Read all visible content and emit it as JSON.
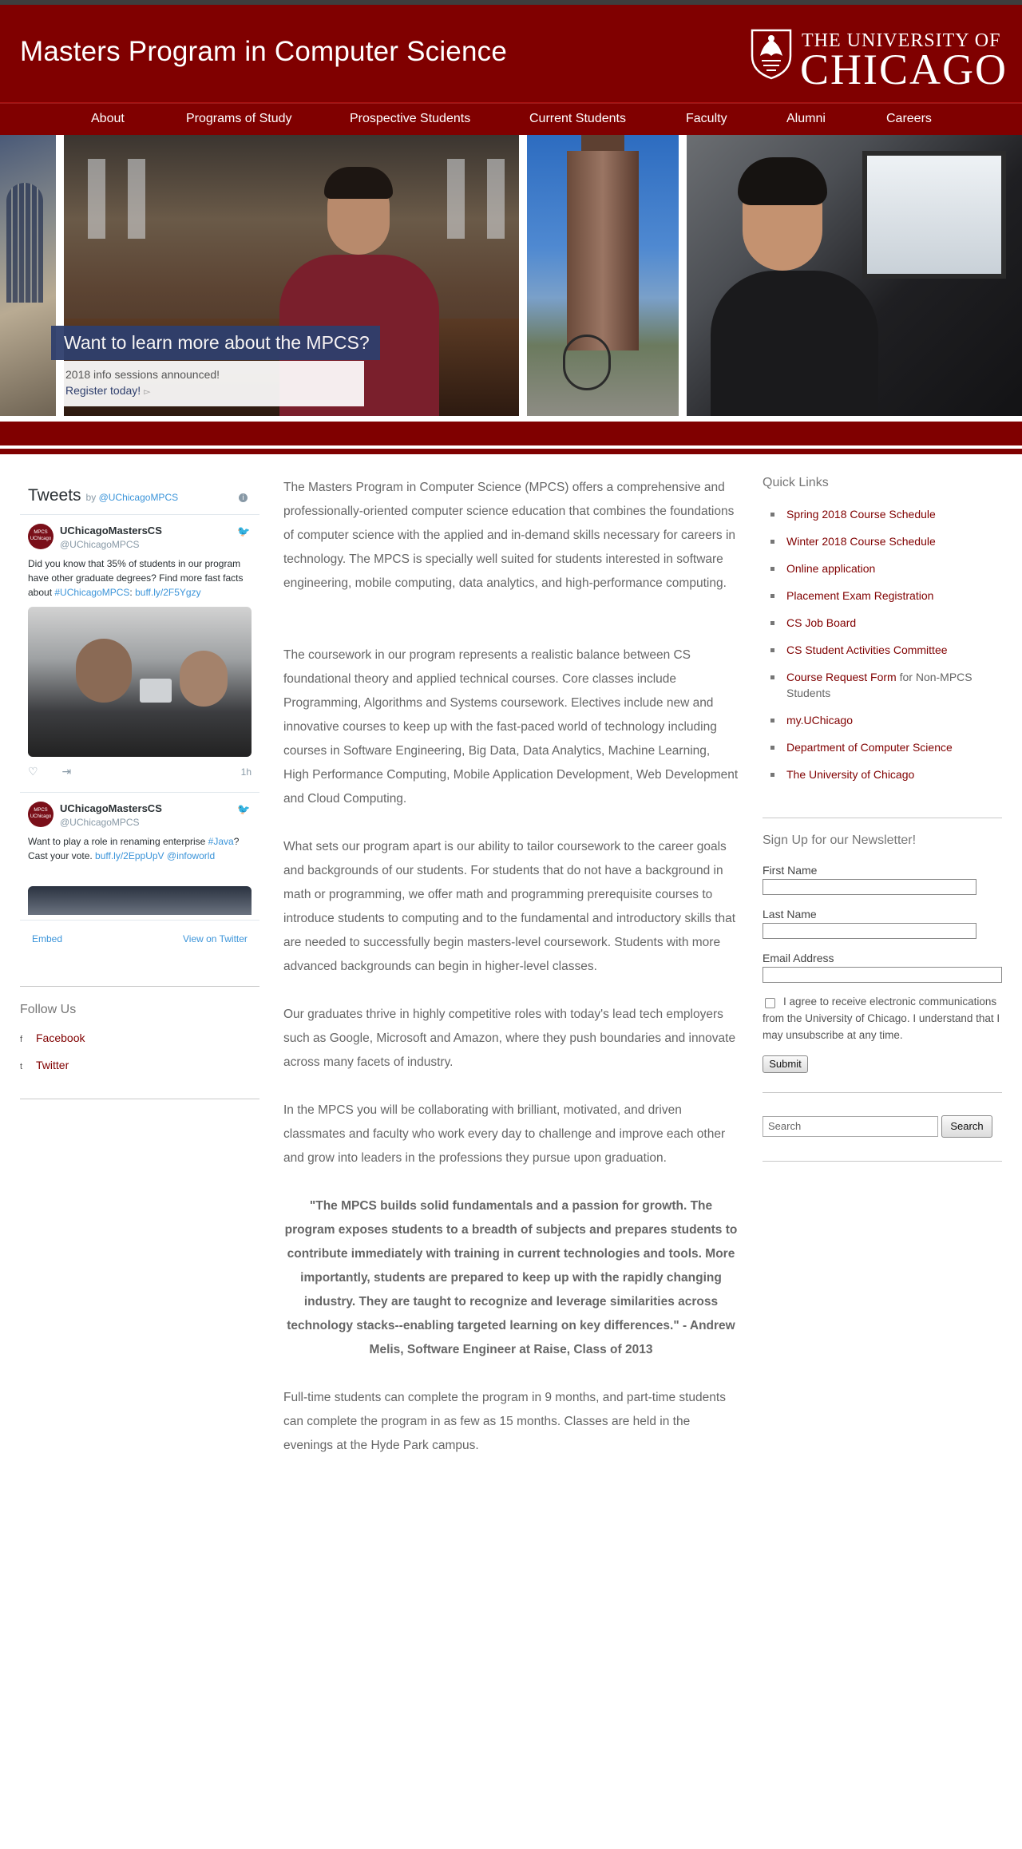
{
  "header": {
    "site_title": "Masters Program in Computer Science",
    "logo_line1": "THE UNIVERSITY OF",
    "logo_line2": "CHICAGO"
  },
  "nav": [
    "About",
    "Programs of Study",
    "Prospective Students",
    "Current Students",
    "Faculty",
    "Alumni",
    "Careers"
  ],
  "hero": {
    "caption": "Want to learn more about the MPCS?",
    "sub_line1": "2018 info sessions announced!",
    "sub_line2": "Register today!",
    "arrow": "▻"
  },
  "tweets": {
    "title": "Tweets",
    "by_prefix": "by",
    "by_handle": "@UChicagoMPCS",
    "items": [
      {
        "name": "UChicagoMastersCS",
        "handle": "@UChicagoMPCS",
        "text_parts": [
          "Did you know that 35% of students in our program have other graduate degrees?  Find more fast facts about ",
          "#UChicagoMPCS",
          ": ",
          "buff.ly/2F5Ygzy"
        ],
        "time": "1h"
      },
      {
        "name": "UChicagoMastersCS",
        "handle": "@UChicagoMPCS",
        "text_parts": [
          "Want to play a role in renaming enterprise ",
          "#Java",
          "? Cast your vote. ",
          "buff.ly/2EppUpV",
          " ",
          "@infoworld"
        ]
      }
    ],
    "avatar_text": "MPCS UChicago",
    "embed": "Embed",
    "view_on_twitter": "View on Twitter"
  },
  "follow": {
    "title": "Follow Us",
    "items": [
      "Facebook",
      "Twitter"
    ]
  },
  "main": {
    "paragraphs": [
      "The Masters Program in Computer Science (MPCS) offers a comprehensive and professionally-oriented computer science education that combines the foundations of computer science with the applied and in-demand skills necessary for careers in technology. The MPCS is specially well suited for students interested in software engineering, mobile computing, data analytics, and high-performance computing.",
      "The coursework in our program represents a realistic balance between CS foundational theory and applied technical courses. Core classes include Programming, Algorithms and Systems coursework. Electives include new and innovative courses to keep up with the fast-paced world of technology including courses in Software Engineering, Big Data, Data Analytics, Machine Learning, High Performance Computing, Mobile Application Development, Web Development and Cloud Computing.",
      "What sets our program apart is our ability to tailor coursework to the career goals and backgrounds of our students. For students that do not have a background in math or programming, we offer math and programming prerequisite courses to introduce students to computing and to the fundamental and introductory skills that are needed to successfully begin masters-level coursework. Students with more advanced backgrounds can begin in higher-level classes.",
      "Our graduates thrive in highly competitive roles with today's lead tech employers such as Google, Microsoft and Amazon, where they push boundaries and innovate across many facets of industry.",
      "In the MPCS you will be collaborating with brilliant, motivated, and driven classmates and faculty who work every day to challenge and improve each other and grow into leaders in the professions they pursue upon graduation."
    ],
    "quote": "\"The MPCS builds solid fundamentals and a passion for growth. The program exposes students to a breadth of subjects and prepares students to contribute immediately with training in current technologies and tools. More importantly, students are prepared to keep up with the rapidly changing industry. They are taught to recognize and leverage similarities across technology stacks--enabling targeted learning on key differences.\" -  Andrew Melis, Software Engineer at Raise, Class of 2013",
    "closing": "Full-time students can complete the program in 9 months, and part-time students can complete the program in as few as 15 months. Classes are held in the evenings at the Hyde Park campus."
  },
  "quick_links": {
    "title": "Quick Links",
    "items": [
      {
        "label": "Spring 2018 Course Schedule",
        "tail": ""
      },
      {
        "label": "Winter 2018 Course Schedule",
        "tail": ""
      },
      {
        "label": "Online application",
        "tail": ""
      },
      {
        "label": "Placement Exam Registration",
        "tail": ""
      },
      {
        "label": "CS Job Board",
        "tail": ""
      },
      {
        "label": "CS Student Activities Committee",
        "tail": ""
      },
      {
        "label": "Course Request Form",
        "tail": " for Non-MPCS Students"
      },
      {
        "label": " my.UChicago",
        "tail": ""
      },
      {
        "label": "Department of Computer Science",
        "tail": ""
      },
      {
        "label": "The University of Chicago",
        "tail": ""
      }
    ]
  },
  "newsletter": {
    "title": "Sign Up for our Newsletter!",
    "first_name": "First Name",
    "last_name": "Last Name",
    "email": "Email Address",
    "agree": "I agree to receive electronic communications from the University of Chicago. I understand that I may unsubscribe at any time.",
    "submit": "Submit"
  },
  "search": {
    "placeholder": "Search",
    "button": "Search"
  },
  "colors": {
    "maroon": "#800000",
    "caption_blue": "#2f3f6d",
    "twitter_blue": "#3b94d9"
  }
}
